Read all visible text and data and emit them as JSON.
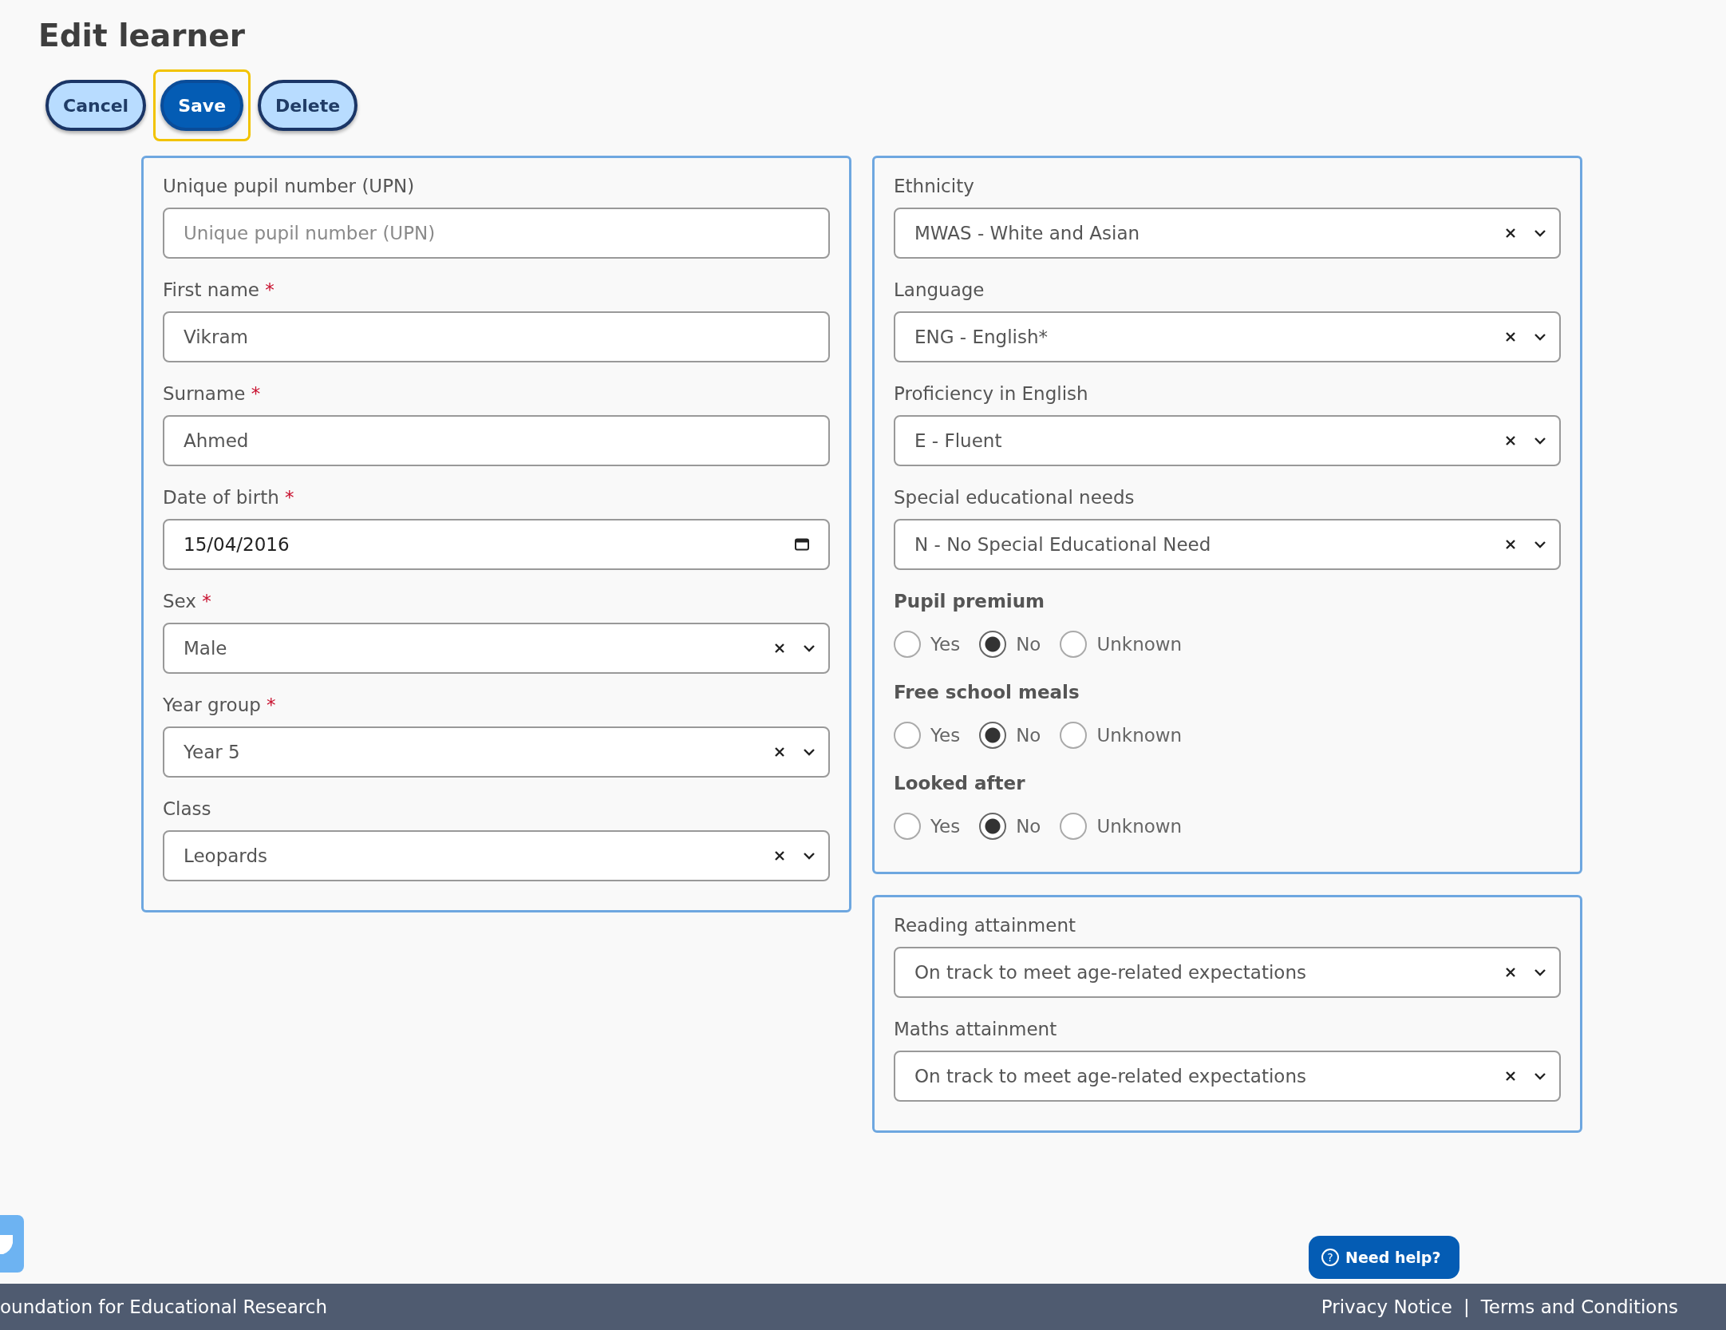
{
  "title": "Edit learner",
  "buttons": [
    {
      "label": "Cancel",
      "kind": "secondary",
      "focused": false
    },
    {
      "label": "Save",
      "kind": "primary",
      "focused": true
    },
    {
      "label": "Delete",
      "kind": "secondary",
      "focused": false
    }
  ],
  "left_panel": {
    "fields": [
      {
        "label": "Unique pupil number (UPN)",
        "kind": "text",
        "required": false,
        "placeholder": "Unique pupil number (UPN)"
      },
      {
        "label": "First name",
        "kind": "text",
        "required": true,
        "value": "Vikram"
      },
      {
        "label": "Surname",
        "kind": "text",
        "required": true,
        "value": "Ahmed"
      },
      {
        "label": "Date of birth",
        "kind": "date",
        "required": true,
        "value": "15/04/2016"
      },
      {
        "label": "Sex",
        "kind": "select",
        "required": true,
        "value": "Male"
      },
      {
        "label": "Year group",
        "kind": "select",
        "required": true,
        "value": "Year 5"
      },
      {
        "label": "Class",
        "kind": "select",
        "required": false,
        "value": "Leopards"
      }
    ]
  },
  "right_panel": {
    "fields": [
      {
        "label": "Ethnicity",
        "kind": "select",
        "required": false,
        "value": "MWAS - White and Asian"
      },
      {
        "label": "Language",
        "kind": "select",
        "required": false,
        "value": "ENG - English*"
      },
      {
        "label": "Proficiency in English",
        "kind": "select",
        "required": false,
        "value": "E - Fluent"
      },
      {
        "label": "Special educational needs",
        "kind": "select",
        "required": false,
        "value": "N - No Special Educational Need"
      }
    ],
    "radio_groups": [
      {
        "label": "Pupil premium",
        "options": [
          {
            "label": "Yes",
            "selected": false
          },
          {
            "label": "No",
            "selected": true
          },
          {
            "label": "Unknown",
            "selected": false
          }
        ]
      },
      {
        "label": "Free school meals",
        "options": [
          {
            "label": "Yes",
            "selected": false
          },
          {
            "label": "No",
            "selected": true
          },
          {
            "label": "Unknown",
            "selected": false
          }
        ]
      },
      {
        "label": "Looked after",
        "options": [
          {
            "label": "Yes",
            "selected": false
          },
          {
            "label": "No",
            "selected": true
          },
          {
            "label": "Unknown",
            "selected": false
          }
        ]
      }
    ]
  },
  "attainment_panel": {
    "fields": [
      {
        "label": "Reading attainment",
        "kind": "select",
        "required": false,
        "value": "On track to meet age-related expectations"
      },
      {
        "label": "Maths attainment",
        "kind": "select",
        "required": false,
        "value": "On track to meet age-related expectations"
      }
    ]
  },
  "required_marker": "*",
  "help_button": {
    "icon": "?",
    "label": "Need help?"
  },
  "footer": {
    "organisation": "oundation for Educational Research",
    "links": [
      "Privacy Notice",
      "Terms and Conditions"
    ],
    "separator": "|"
  }
}
